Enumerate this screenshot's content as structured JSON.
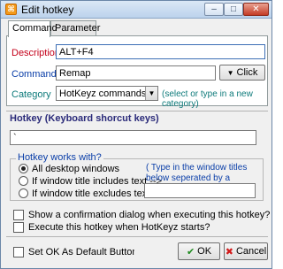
{
  "window": {
    "title": "Edit hotkey",
    "controls": {
      "minimize": "–",
      "maximize": "□",
      "close": "✕"
    }
  },
  "tabs": [
    {
      "label": "Command"
    },
    {
      "label": "Parameter"
    }
  ],
  "form": {
    "description_label": "Description",
    "description_value": "ALT+F4",
    "command_label": "Command",
    "command_value": "Remap",
    "click_button": "Click",
    "category_label": "Category",
    "category_value": "HotKeyz commands",
    "category_hint": "(select or type in a new category)"
  },
  "hotkey": {
    "title": "Hotkey (Keyboard shorcut keys)",
    "value": "`",
    "works_with_title": "Hotkey works with?",
    "options": [
      "All desktop windows",
      "If window title includes text -->",
      "If window title excludes text -->"
    ],
    "hint": "( Type in the window titles below seperated by a comma , )"
  },
  "checks": {
    "confirm": "Show a confirmation dialog when executing this hotkey?",
    "execute_start": "Execute this hotkey when HotKeyz starts?",
    "default_ok": "Set OK As Default Button (With th"
  },
  "buttons": {
    "ok": "OK",
    "cancel": "Cancel"
  },
  "colors": {
    "accent_red": "#c4001a",
    "accent_blue": "#0a3ea8",
    "teal": "#0d7a7a"
  },
  "icons": {
    "app": "hotkey-app-icon",
    "click": "cursor-arrow-icon",
    "ok": "checkmark-icon",
    "cancel": "red-x-icon"
  }
}
